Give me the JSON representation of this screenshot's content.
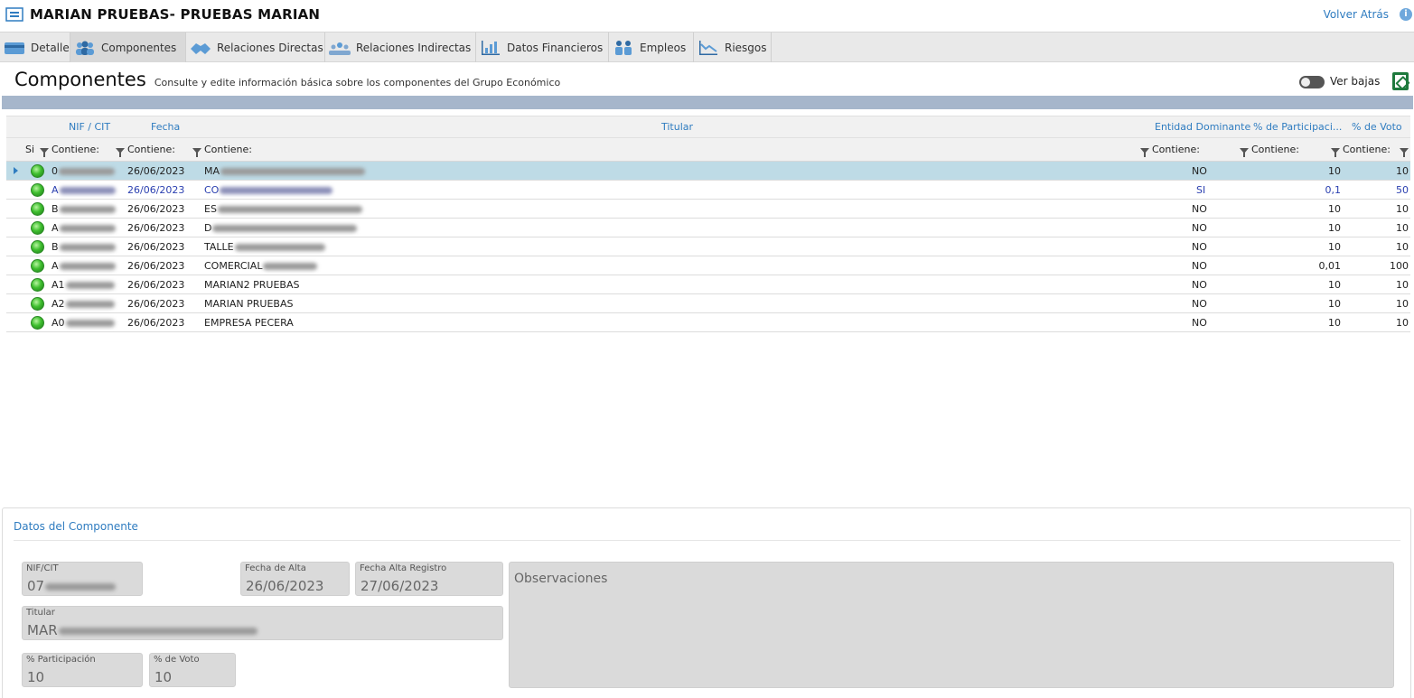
{
  "header": {
    "title": "MARIAN PRUEBAS- PRUEBAS MARIAN",
    "back_label": "Volver Atrás",
    "info_label": "i"
  },
  "tabs": [
    {
      "label": "Detalle",
      "icon": "card-icon",
      "active": false
    },
    {
      "label": "Componentes",
      "icon": "people-icon",
      "active": true
    },
    {
      "label": "Relaciones Directas",
      "icon": "handshake-icon",
      "active": false
    },
    {
      "label": "Relaciones Indirectas",
      "icon": "group-icon",
      "active": false
    },
    {
      "label": "Datos Financieros",
      "icon": "bar-chart-icon",
      "active": false
    },
    {
      "label": "Empleos",
      "icon": "workers-icon",
      "active": false
    },
    {
      "label": "Riesgos",
      "icon": "line-chart-icon",
      "active": false
    }
  ],
  "section": {
    "title": "Componentes",
    "subtitle": "Consulte y edite información básica sobre los componentes del Grupo Económico",
    "toggle_label": "Ver bajas"
  },
  "grid": {
    "columns": {
      "nif": "NIF / CIT",
      "fecha": "Fecha",
      "titular": "Titular",
      "dominante": "Entidad Dominante",
      "participacion": "% de Participaci...",
      "voto": "% de Voto"
    },
    "filter": {
      "si": "Si",
      "contains": "Contiene:"
    },
    "rows": [
      {
        "nif": "0",
        "fecha": "26/06/2023",
        "titular": "MA",
        "dominante": "NO",
        "participacion": "10",
        "voto": "10"
      },
      {
        "nif": "A",
        "fecha": "26/06/2023",
        "titular": "CO",
        "dominante": "SI",
        "participacion": "0,1",
        "voto": "50"
      },
      {
        "nif": "B",
        "fecha": "26/06/2023",
        "titular": "ES",
        "dominante": "NO",
        "participacion": "10",
        "voto": "10"
      },
      {
        "nif": "A",
        "fecha": "26/06/2023",
        "titular": "D",
        "dominante": "NO",
        "participacion": "10",
        "voto": "10"
      },
      {
        "nif": "B",
        "fecha": "26/06/2023",
        "titular": "TALLE",
        "dominante": "NO",
        "participacion": "10",
        "voto": "10"
      },
      {
        "nif": "A",
        "fecha": "26/06/2023",
        "titular": "COMERCIAL",
        "dominante": "NO",
        "participacion": "0,01",
        "voto": "100"
      },
      {
        "nif": "A1",
        "fecha": "26/06/2023",
        "titular": "MARIAN2 PRUEBAS",
        "dominante": "NO",
        "participacion": "10",
        "voto": "10"
      },
      {
        "nif": "A2",
        "fecha": "26/06/2023",
        "titular": "MARIAN PRUEBAS",
        "dominante": "NO",
        "participacion": "10",
        "voto": "10"
      },
      {
        "nif": "A0",
        "fecha": "26/06/2023",
        "titular": "EMPRESA PECERA",
        "dominante": "NO",
        "participacion": "10",
        "voto": "10"
      }
    ]
  },
  "detail": {
    "title": "Datos del Componente",
    "nif_label": "NIF/CIT",
    "nif_value": "07",
    "fecha_alta_label": "Fecha de Alta",
    "fecha_alta_value": "26/06/2023",
    "fecha_registro_label": "Fecha Alta Registro",
    "fecha_registro_value": "27/06/2023",
    "titular_label": "Titular",
    "titular_value": "MAR",
    "participacion_label": "% Participación",
    "participacion_value": "10",
    "voto_label": "% de Voto",
    "voto_value": "10",
    "observaciones_label": "Observaciones"
  }
}
